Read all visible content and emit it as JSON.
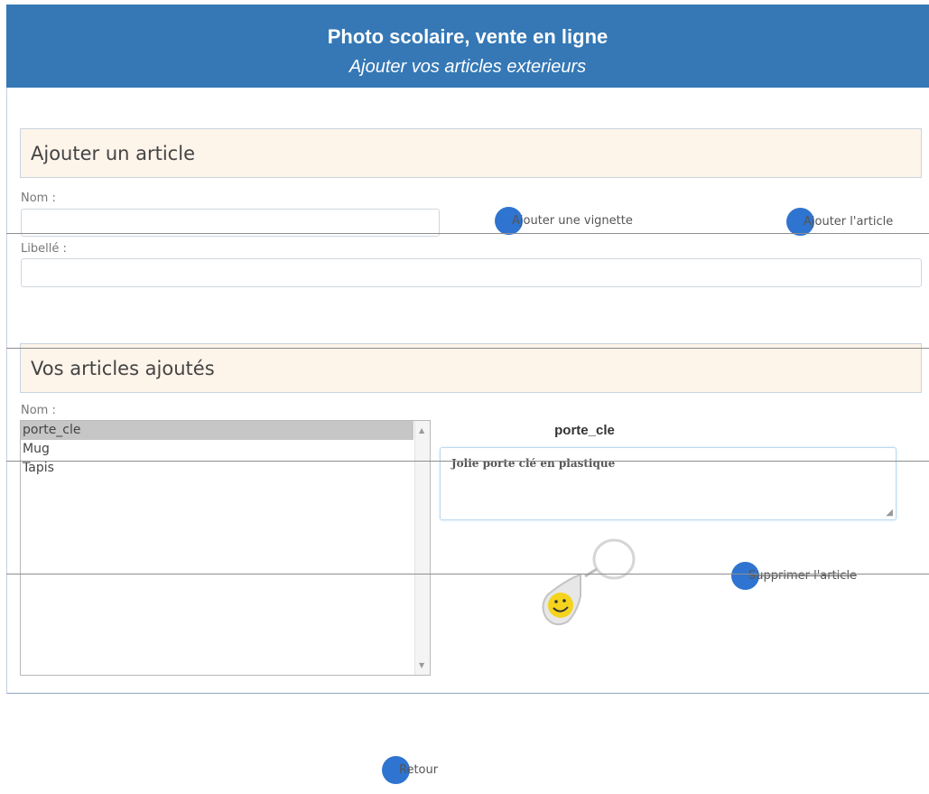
{
  "header": {
    "title": "Photo scolaire, vente en ligne",
    "subtitle": "Ajouter vos articles exterieurs"
  },
  "add_section": {
    "heading": "Ajouter un article",
    "name_label": "Nom :",
    "name_value": "",
    "libelle_label": "Libellé :",
    "libelle_value": "",
    "add_thumbnail_label": "Ajouter une vignette",
    "add_article_label": "Ajouter l'article"
  },
  "list_section": {
    "heading": "Vos articles ajoutés",
    "name_label": "Nom :",
    "items": [
      {
        "label": "porte_cle",
        "selected": true
      },
      {
        "label": "Mug",
        "selected": false
      },
      {
        "label": "Tapis",
        "selected": false
      }
    ],
    "selected_name": "porte_cle",
    "description": "Jolie porte clé en plastique",
    "delete_label": "Supprimer l'article"
  },
  "footer": {
    "back_label": "Retour"
  },
  "colors": {
    "header_bg": "#3578b5",
    "section_bg": "#fdf4ea",
    "dot": "#2f74d0",
    "selected_item_bg": "#c6c6c6"
  },
  "icons": {
    "keychain": "smiley-keychain-image"
  }
}
